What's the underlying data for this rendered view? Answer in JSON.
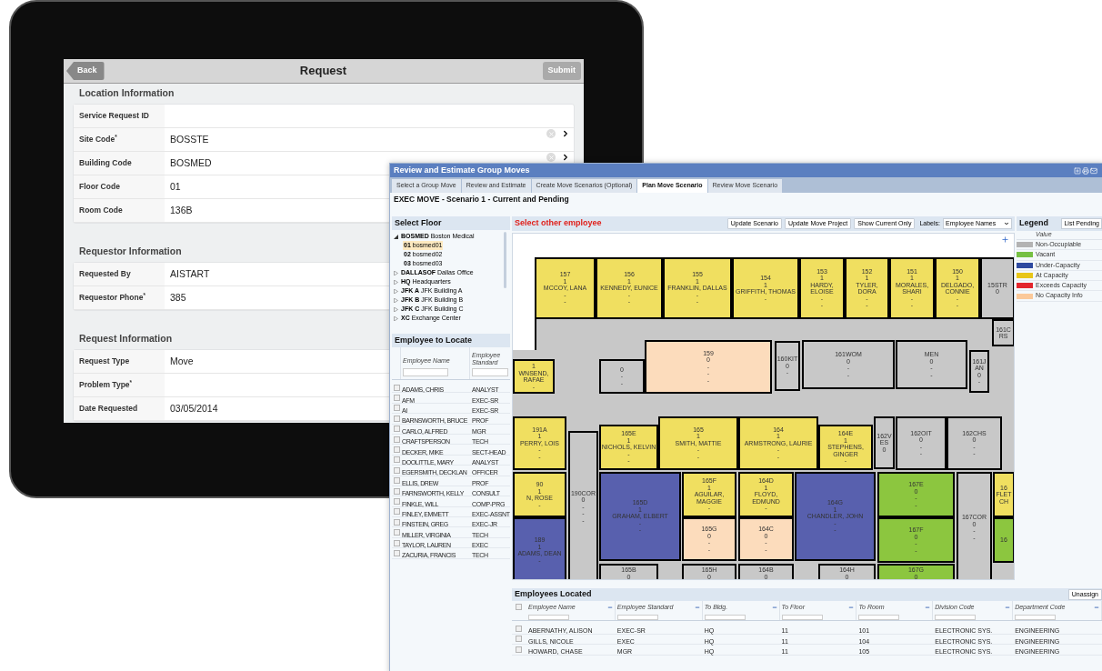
{
  "tablet": {
    "header": {
      "back": "Back",
      "title": "Request",
      "submit": "Submit"
    },
    "sections": [
      {
        "title": "Location Information",
        "rows": [
          {
            "label": "Service Request ID",
            "kind": "text"
          },
          {
            "label": "Site Code$^{*}$",
            "value": "BOSSTE",
            "kind": "lookup"
          },
          {
            "label": "Building Code",
            "value": "BOSMED",
            "kind": "lookup"
          },
          {
            "label": "Floor Code",
            "value": "01",
            "kind": "text"
          },
          {
            "label": "Room Code",
            "value": "136B",
            "kind": "text"
          }
        ]
      },
      {
        "title": "Requestor Information",
        "rows": [
          {
            "label": "Requested By",
            "value": "AISTART",
            "kind": "text"
          },
          {
            "label": "Requestor Phone$^{*}$",
            "value": "385",
            "kind": "text"
          }
        ]
      },
      {
        "title": "Request Information",
        "rows": [
          {
            "label": "Request Type",
            "value": "Move",
            "kind": "text"
          },
          {
            "label": "Problem Type$^{*}$",
            "kind": "text"
          },
          {
            "label": "Date Requested",
            "value": "03/05/2014",
            "kind": "text"
          }
        ]
      }
    ]
  },
  "window": {
    "title": "Review and Estimate Group Moves",
    "tabs": [
      {
        "label": "Select a Group Move",
        "selected": false
      },
      {
        "label": "Review and Estimate",
        "selected": false
      },
      {
        "label": "Create Move Scenarios (Optional)",
        "selected": false
      },
      {
        "label": "Plan Move Scenario",
        "selected": true
      },
      {
        "label": "Review Move Scenario",
        "selected": false
      }
    ],
    "subtitle": "EXEC MOVE - Scenario 1 - Current and Pending",
    "floor_panel": {
      "title": "Select Floor",
      "tree": [
        {
          "code": "BOSMED",
          "name": "Boston Medical",
          "expanded": true,
          "selected": false,
          "children": [
            {
              "code": "01",
              "name": "bosmed01",
              "selected": true
            },
            {
              "code": "02",
              "name": "bosmed02",
              "selected": false
            },
            {
              "code": "03",
              "name": "bosmed03",
              "selected": false
            }
          ]
        },
        {
          "code": "DALLASOF",
          "name": "Dallas Office",
          "expanded": false,
          "selected": false
        },
        {
          "code": "HQ",
          "name": "Headquarters",
          "expanded": false,
          "selected": false
        },
        {
          "code": "JFK A",
          "name": "JFK Building A",
          "expanded": false,
          "selected": false
        },
        {
          "code": "JFK B",
          "name": "JFK Building B",
          "expanded": false,
          "selected": false
        },
        {
          "code": "JFK C",
          "name": "JFK Building C",
          "expanded": false,
          "selected": false
        },
        {
          "code": "XC",
          "name": "Exchange Center",
          "expanded": false,
          "selected": false
        }
      ]
    },
    "employee_panel": {
      "title": "Employee to Locate",
      "columns": [
        "Employee Name",
        "Employee Standard"
      ],
      "rows": [
        {
          "checked": false,
          "name": "ADAMS, CHRIS",
          "standard": "ANALYST"
        },
        {
          "checked": false,
          "name": "AFM",
          "standard": "EXEC-SR"
        },
        {
          "checked": false,
          "name": "AI",
          "standard": "EXEC-SR"
        },
        {
          "checked": false,
          "name": "BARNSWORTH, BRUCE",
          "standard": "PROF"
        },
        {
          "checked": false,
          "name": "CARLO, ALFRED",
          "standard": "MGR"
        },
        {
          "checked": false,
          "name": "CRAFTSPERSON",
          "standard": "TECH"
        },
        {
          "checked": false,
          "name": "DECKER, MIKE",
          "standard": "SECT-HEAD"
        },
        {
          "checked": false,
          "name": "DOOLITTLE, MARY",
          "standard": "ANALYST"
        },
        {
          "checked": false,
          "name": "EGERSMITH, DECKLAN",
          "standard": "OFFICER"
        },
        {
          "checked": false,
          "name": "ELLIS, DREW",
          "standard": "PROF"
        },
        {
          "checked": false,
          "name": "FARNSWORTH, KELLY",
          "standard": "CONSULT"
        },
        {
          "checked": false,
          "name": "FINKLE, WILL",
          "standard": "COMP-PRG"
        },
        {
          "checked": false,
          "name": "FINLEY, EMMETT",
          "standard": "EXEC-ASSNT"
        },
        {
          "checked": false,
          "name": "FINSTEIN, GREG",
          "standard": "EXEC-JR"
        },
        {
          "checked": false,
          "name": "MILLER, VIRGINIA",
          "standard": "TECH"
        },
        {
          "checked": false,
          "name": "TAYLOR, LAUREN",
          "standard": "EXEC"
        },
        {
          "checked": false,
          "name": "ZACURIA, FRANCIS",
          "standard": "TECH"
        }
      ]
    },
    "plan_toolbar": {
      "title": "Select other employee",
      "buttons": [
        "Update Scenario",
        "Update Move Project",
        "Show Current Only"
      ],
      "labels_label": "Labels:",
      "labels_value": "Employee Names"
    },
    "floor_plan": {
      "rooms": [
        {
          "color": "#f0df60",
          "lines": [
            "157",
            "1",
            "MCCOY, LANA",
            "-",
            "-"
          ]
        },
        {
          "color": "#f0df60",
          "lines": [
            "156",
            "1",
            "KENNEDY, EUNICE",
            "-",
            "-"
          ]
        },
        {
          "color": "#f0df60",
          "lines": [
            "155",
            "1",
            "FRANKLIN, DALLAS",
            "-",
            "-"
          ]
        },
        {
          "color": "#f0df60",
          "lines": [
            "154",
            "1",
            "GRIFFITH, THOMAS",
            "-"
          ]
        },
        {
          "color": "#f0df60",
          "lines": [
            "153",
            "1",
            "HARDY, ELOISE",
            "-",
            "-"
          ]
        },
        {
          "color": "#f0df60",
          "lines": [
            "152",
            "1",
            "TYLER, DORA",
            "-",
            "-"
          ]
        },
        {
          "color": "#f0df60",
          "lines": [
            "151",
            "1",
            "MORALES, SHARI",
            "-",
            "-"
          ]
        },
        {
          "color": "#f0df60",
          "lines": [
            "150",
            "1",
            "DELGADO, CONNIE",
            "-",
            "-"
          ]
        },
        {
          "color": "#c8c8c8",
          "lines": [
            "15STR",
            "0"
          ]
        },
        {
          "color": "#f0df60",
          "lines": [
            "1",
            "WNSEND, RAFAE",
            "-"
          ]
        },
        {
          "color": "#c8c8c8",
          "lines": [
            "0",
            "-",
            "-"
          ]
        },
        {
          "color": "#fcdcbc",
          "lines": [
            "159",
            "0",
            "-",
            "-",
            "-"
          ]
        },
        {
          "color": "#c8c8c8",
          "lines": [
            "160KIT",
            "0",
            "-"
          ]
        },
        {
          "color": "#c8c8c8",
          "lines": [
            "161WOM",
            "0",
            "-",
            "-"
          ]
        },
        {
          "color": "#c8c8c8",
          "lines": [
            "MEN",
            "0",
            "-",
            "-"
          ]
        },
        {
          "color": "#c8c8c8",
          "lines": [
            "161JAN",
            "0",
            "-"
          ]
        },
        {
          "color": "#c8c8c8",
          "lines": [
            "161CRS"
          ]
        },
        {
          "color": "#f0df60",
          "lines": [
            "191A",
            "1",
            "PERRY, LOIS",
            "-",
            "-"
          ]
        },
        {
          "color": "#c8c8c8",
          "lines": [
            "190COR",
            "0",
            "-",
            "-",
            "-"
          ]
        },
        {
          "color": "#f0df60",
          "lines": [
            "165E",
            "1",
            "NICHOLS, KELVIN",
            "-",
            "-"
          ]
        },
        {
          "color": "#f0df60",
          "lines": [
            "165",
            "1",
            "SMITH, MATTIE",
            "-",
            "-"
          ]
        },
        {
          "color": "#f0df60",
          "lines": [
            "164",
            "1",
            "ARMSTRONG, LAURIE",
            "-",
            "-"
          ]
        },
        {
          "color": "#f0df60",
          "lines": [
            "164E",
            "1",
            "STEPHENS, GINGER",
            "-"
          ]
        },
        {
          "color": "#c8c8c8",
          "lines": [
            "162VES",
            "0"
          ]
        },
        {
          "color": "#c8c8c8",
          "lines": [
            "162OIT",
            "0",
            "-",
            "-"
          ]
        },
        {
          "color": "#c8c8c8",
          "lines": [
            "162CHS",
            "0",
            "-",
            "-"
          ]
        },
        {
          "color": "#f0df60",
          "lines": [
            "90",
            "1",
            "N, ROSE",
            "-"
          ]
        },
        {
          "color": "#5860ae",
          "lines": [
            "165D",
            "1",
            "GRAHAM, ELBERT",
            "-",
            "-"
          ]
        },
        {
          "color": "#f0df60",
          "lines": [
            "165F",
            "1",
            "AGUILAR, MAGGIE",
            "-"
          ]
        },
        {
          "color": "#f0df60",
          "lines": [
            "164D",
            "1",
            "FLOYD, EDMUND",
            "-"
          ]
        },
        {
          "color": "#5860ae",
          "lines": [
            "164G",
            "1",
            "CHANDLER, JOHN",
            "-",
            "-"
          ]
        },
        {
          "color": "#8cc63f",
          "lines": [
            "167E",
            "0",
            "-",
            "-"
          ]
        },
        {
          "color": "#c8c8c8",
          "lines": [
            "167COR",
            "0",
            "-",
            "-"
          ]
        },
        {
          "color": "#f0df60",
          "lines": [
            "16",
            "FLETCH"
          ]
        },
        {
          "color": "#5860ae",
          "lines": [
            "189",
            "1",
            "ADAMS, DEAN",
            "-"
          ]
        },
        {
          "color": "#fcdcbc",
          "lines": [
            "165G",
            "0",
            "-",
            "-"
          ]
        },
        {
          "color": "#fcdcbc",
          "lines": [
            "164C",
            "0",
            "-",
            "-"
          ]
        },
        {
          "color": "#8cc63f",
          "lines": [
            "167F",
            "0",
            "-",
            "-"
          ]
        },
        {
          "color": "#8cc63f",
          "lines": [
            "16"
          ]
        },
        {
          "color": "#c8c8c8",
          "lines": [
            "165B",
            "0"
          ]
        },
        {
          "color": "#c8c8c8",
          "lines": [
            "165H",
            "0"
          ]
        },
        {
          "color": "#c8c8c8",
          "lines": [
            "164B",
            "0"
          ]
        },
        {
          "color": "#c8c8c8",
          "lines": [
            "164H",
            "0"
          ]
        },
        {
          "color": "#8cc63f",
          "lines": [
            "167G",
            "0"
          ]
        }
      ]
    },
    "legend": {
      "title": "Legend",
      "button": "List Pending",
      "column": "Value",
      "items": [
        {
          "label": "Non-Occupiable",
          "color": "#b3b3b3"
        },
        {
          "label": "Vacant",
          "color": "#76c043"
        },
        {
          "label": "Under-Capacity",
          "color": "#2e4aa0"
        },
        {
          "label": "At Capacity",
          "color": "#e8c61a"
        },
        {
          "label": "Exceeds Capacity",
          "color": "#e3262d"
        },
        {
          "label": "No Capacity Info",
          "color": "#fbc99a"
        }
      ]
    },
    "located": {
      "title": "Employees Located",
      "button": "Unassign",
      "all_checked": false,
      "columns": [
        "Employee Name",
        "Employee Standard",
        "To Bldg.",
        "To Floor",
        "To Room",
        "Division Code",
        "Department Code"
      ],
      "rows": [
        {
          "checked": false,
          "cells": [
            "ABERNATHY, ALISON",
            "EXEC-SR",
            "HQ",
            "11",
            "101",
            "ELECTRONIC SYS.",
            "ENGINEERING"
          ]
        },
        {
          "checked": false,
          "cells": [
            "GILLS, NICOLE",
            "EXEC",
            "HQ",
            "11",
            "104",
            "ELECTRONIC SYS.",
            "ENGINEERING"
          ]
        },
        {
          "checked": false,
          "cells": [
            "HOWARD, CHASE",
            "MGR",
            "HQ",
            "11",
            "105",
            "ELECTRONIC SYS.",
            "ENGINEERING"
          ]
        }
      ]
    }
  }
}
